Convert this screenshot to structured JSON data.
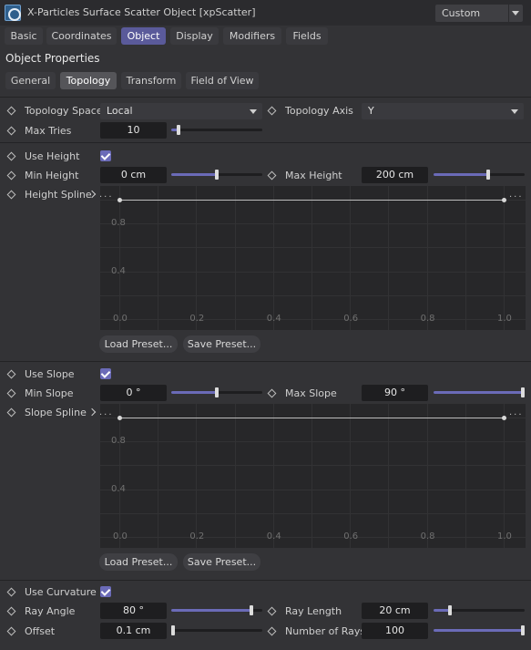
{
  "window": {
    "title": "X-Particles Surface Scatter Object [xpScatter]",
    "preset": "Custom"
  },
  "tabs": [
    "Basic",
    "Coordinates",
    "Object",
    "Display",
    "Modifiers",
    "Fields"
  ],
  "section_title": "Object Properties",
  "subtabs": [
    "General",
    "Topology",
    "Transform",
    "Field of View"
  ],
  "topology": {
    "space_label": "Topology Space",
    "space_value": "Local",
    "axis_label": "Topology Axis",
    "axis_value": "Y",
    "max_tries_label": "Max Tries",
    "max_tries_value": "10",
    "max_tries_slider": 0.08
  },
  "height": {
    "use_label": "Use Height",
    "use_checked": true,
    "min_label": "Min Height",
    "min_value": "0 cm",
    "min_slider": 0.5,
    "max_label": "Max Height",
    "max_value": "200 cm",
    "max_slider": 0.6,
    "spline_label": "Height Spline",
    "load_label": "Load Preset...",
    "save_label": "Save Preset..."
  },
  "slope": {
    "use_label": "Use Slope",
    "use_checked": true,
    "min_label": "Min Slope",
    "min_value": "0 °",
    "min_slider": 0.5,
    "max_label": "Max Slope",
    "max_value": "90 °",
    "max_slider": 1.0,
    "spline_label": "Slope Spline",
    "load_label": "Load Preset...",
    "save_label": "Save Preset..."
  },
  "curvature": {
    "use_label": "Use Curvature",
    "use_checked": true,
    "ray_angle_label": "Ray Angle",
    "ray_angle_value": "80 °",
    "ray_angle_slider": 0.88,
    "ray_length_label": "Ray Length",
    "ray_length_value": "20 cm",
    "ray_length_slider": 0.18,
    "offset_label": "Offset",
    "offset_value": "0.1 cm",
    "offset_slider": 0.02,
    "rays_label": "Number of Rays",
    "rays_value": "100",
    "rays_slider": 1.0
  },
  "graph_ticks": {
    "x": [
      "0.0",
      "0.2",
      "0.4",
      "0.6",
      "0.8",
      "1.0"
    ],
    "y": [
      "0.8",
      "0.4"
    ]
  },
  "colors": {
    "accent": "#6b6bb8",
    "active_tab": "#5a5a9a"
  }
}
